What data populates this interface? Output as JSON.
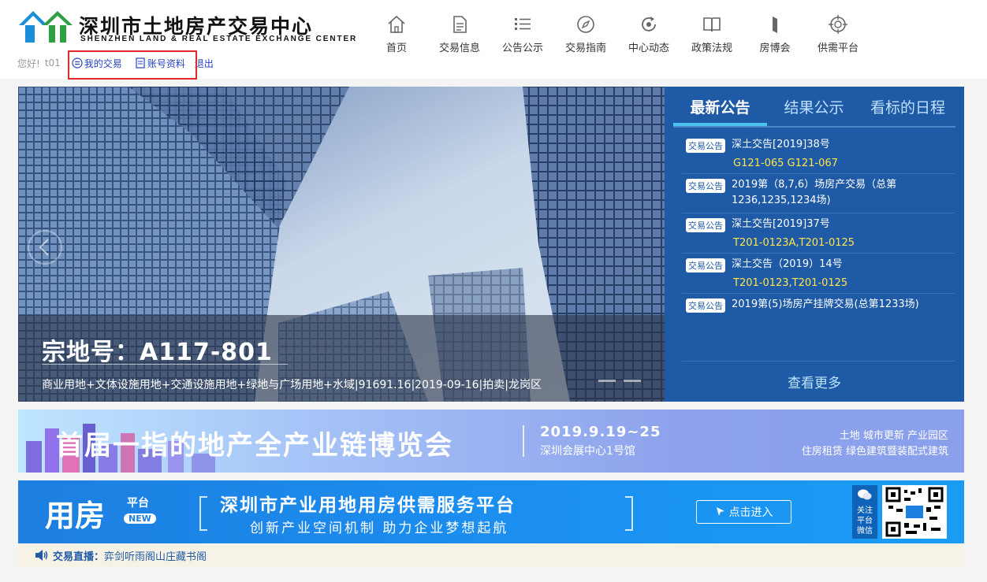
{
  "header": {
    "logo_cn": "深圳市土地房产交易中心",
    "logo_en": "SHENZHEN LAND & REAL ESTATE EXCHANGE CENTER",
    "greeting": "您好!",
    "username": "t01",
    "my_trade": "我的交易",
    "account_info": "账号资料",
    "logout": "退出"
  },
  "nav": [
    {
      "label": "首页",
      "icon": "home-icon"
    },
    {
      "label": "交易信息",
      "icon": "document-icon"
    },
    {
      "label": "公告公示",
      "icon": "list-icon"
    },
    {
      "label": "交易指南",
      "icon": "compass-icon"
    },
    {
      "label": "中心动态",
      "icon": "refresh-icon"
    },
    {
      "label": "政策法规",
      "icon": "book-icon"
    },
    {
      "label": "房博会",
      "icon": "flag-icon"
    },
    {
      "label": "供需平台",
      "icon": "target-icon"
    }
  ],
  "banner": {
    "title": "宗地号：A117-801",
    "subtitle": "商业用地+文体设施用地+交通设施用地+绿地与广场用地+水域|91691.16|2019-09-16|拍卖|龙岗区"
  },
  "news": {
    "tabs": [
      "最新公告",
      "结果公示",
      "看标的日程"
    ],
    "items": [
      {
        "badge": "交易公告",
        "title": "深土交告[2019]38号",
        "code": "G121-065 G121-067"
      },
      {
        "badge": "交易公告",
        "title": "2019第（8,7,6）场房产交易（总第1236,1235,1234场)",
        "code": ""
      },
      {
        "badge": "交易公告",
        "title": "深土交告[2019]37号",
        "code": "T201-0123A,T201-0125"
      },
      {
        "badge": "交易公告",
        "title": "深土交告（2019）14号",
        "code": "T201-0123,T201-0125"
      },
      {
        "badge": "交易公告",
        "title": "2019第(5)场房产挂牌交易(总第1233场)",
        "code": ""
      }
    ],
    "more": "查看更多"
  },
  "ad1": {
    "title": "首届一指的地产全产业链博览会",
    "date": "2019.9.19~25",
    "location": "深圳会展中心1号馆",
    "tags1": "土地  城市更新  产业园区",
    "tags2": "住房租赁  绿色建筑暨装配式建筑"
  },
  "ad2": {
    "logo": "用房",
    "platform": "平台",
    "new": "NEW",
    "title": "深圳市产业用地用房供需服务平台",
    "subtitle": "创新产业空间机制   助力企业梦想起航",
    "button": "点击进入",
    "wechat": "关注平台微信"
  },
  "ticker": {
    "label": "交易直播：",
    "text": "弈剑听雨阁山庄藏书阁"
  }
}
